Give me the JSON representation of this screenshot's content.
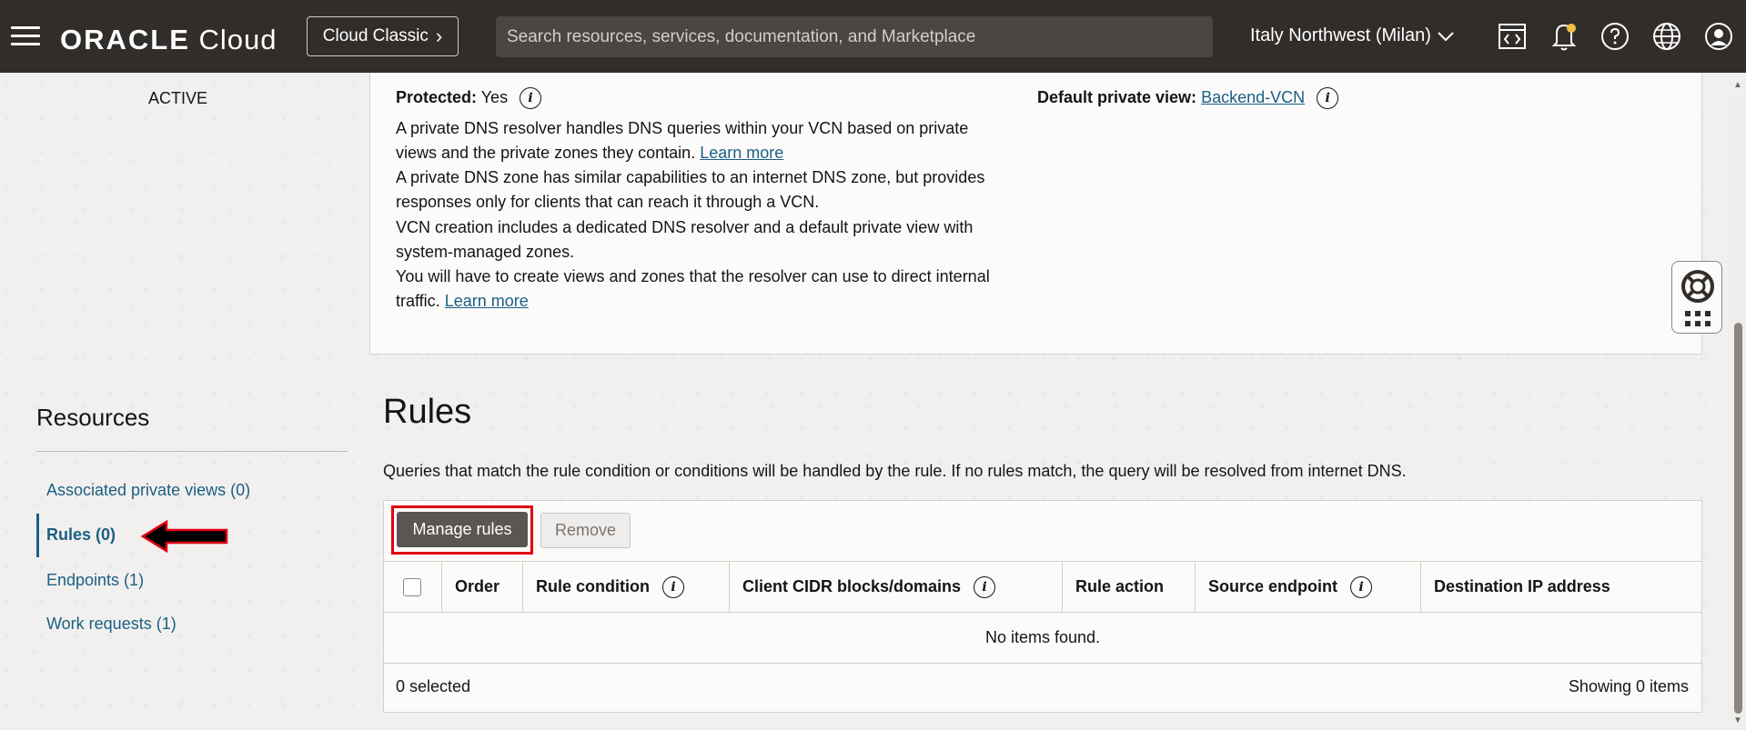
{
  "header": {
    "logo_brand": "ORACLE",
    "logo_product": "Cloud",
    "classic_button": "Cloud Classic",
    "search_placeholder": "Search resources, services, documentation, and Marketplace",
    "region": "Italy Northwest (Milan)",
    "icons": [
      "hamburger-menu-icon",
      "code-editor-icon",
      "bell-icon",
      "help-icon",
      "globe-icon",
      "user-icon"
    ]
  },
  "sidebar": {
    "status": "ACTIVE",
    "resources_title": "Resources",
    "items": [
      {
        "label": "Associated private views (0)",
        "active": false
      },
      {
        "label": "Rules (0)",
        "active": true
      },
      {
        "label": "Endpoints (1)",
        "active": false
      },
      {
        "label": "Work requests (1)",
        "active": false
      }
    ]
  },
  "info": {
    "protected_label": "Protected:",
    "protected_value": "Yes",
    "default_view_label": "Default private view:",
    "default_view_value": "Backend-VCN",
    "lines": [
      "A private DNS resolver handles DNS queries within your VCN based on private",
      "views and the private zones they contain.",
      "A private DNS zone has similar capabilities to an internet DNS zone, but provides",
      "responses only for clients that can reach it through a VCN.",
      "VCN creation includes a dedicated DNS resolver and a default private view with",
      "system-managed zones.",
      "You will have to create views and zones that the resolver can use to direct internal",
      "traffic."
    ],
    "learn_more": "Learn more"
  },
  "rules": {
    "title": "Rules",
    "description": "Queries that match the rule condition or conditions will be handled by the rule. If no rules match, the query will be resolved from internet DNS.",
    "manage_button": "Manage rules",
    "remove_button": "Remove",
    "columns": [
      "Order",
      "Rule condition",
      "Client CIDR blocks/domains",
      "Rule action",
      "Source endpoint",
      "Destination IP address"
    ],
    "empty_message": "No items found.",
    "selected_count": "0 selected",
    "showing": "Showing 0 items"
  },
  "colors": {
    "header_bg": "#312d2a",
    "link": "#1a5f84",
    "highlight": "#e1000f",
    "primary_button": "#5b5652"
  }
}
